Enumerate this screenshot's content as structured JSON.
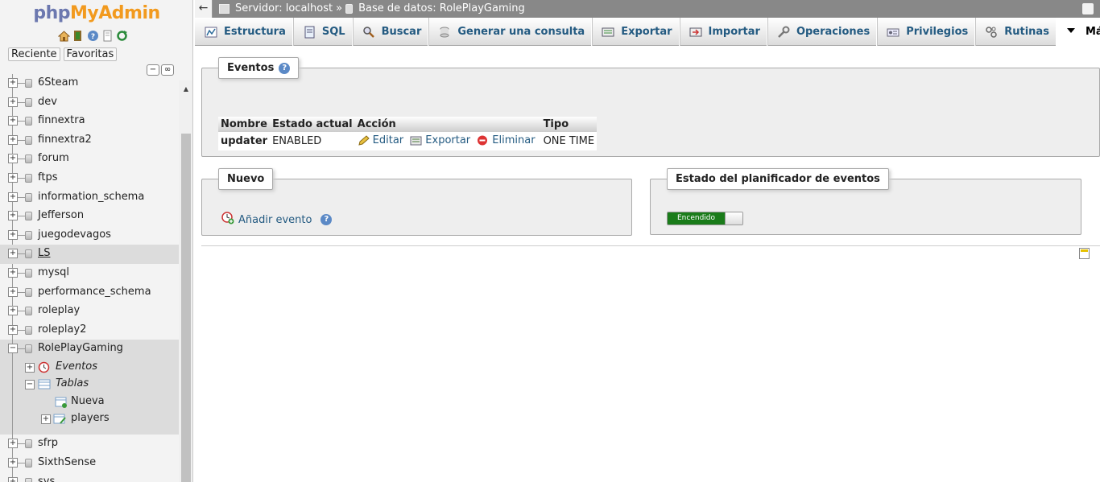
{
  "logo": {
    "left": "php",
    "right": "MyAdmin"
  },
  "nav": {
    "tabs": [
      "Reciente",
      "Favoritas"
    ],
    "icons": [
      "home-icon",
      "logout-icon",
      "help-icon",
      "docs-icon",
      "reload-icon"
    ]
  },
  "tree": {
    "databases_top": [
      {
        "label": "6Steam",
        "underline": false,
        "highlight": false
      },
      {
        "label": "dev",
        "underline": false,
        "highlight": false
      },
      {
        "label": "finnextra",
        "underline": false,
        "highlight": false
      },
      {
        "label": "finnextra2",
        "underline": false,
        "highlight": false
      },
      {
        "label": "forum",
        "underline": false,
        "highlight": false
      },
      {
        "label": "ftps",
        "underline": false,
        "highlight": false
      },
      {
        "label": "information_schema",
        "underline": false,
        "highlight": false
      },
      {
        "label": "Jefferson",
        "underline": false,
        "highlight": false
      },
      {
        "label": "juegodevagos",
        "underline": false,
        "highlight": false
      },
      {
        "label": "LS",
        "underline": true,
        "highlight": true
      },
      {
        "label": "mysql",
        "underline": false,
        "highlight": false
      },
      {
        "label": "performance_schema",
        "underline": false,
        "highlight": false
      },
      {
        "label": "roleplay",
        "underline": false,
        "highlight": false
      },
      {
        "label": "roleplay2",
        "underline": false,
        "highlight": false
      }
    ],
    "active_db": {
      "label": "RolePlayGaming",
      "children": {
        "events": "Eventos",
        "tables": "Tablas",
        "new": "Nueva",
        "players": "players"
      }
    },
    "databases_bottom": [
      {
        "label": "sfrp",
        "underline": false,
        "highlight": false
      },
      {
        "label": "SixthSense",
        "underline": false,
        "highlight": false
      },
      {
        "label": "sys",
        "underline": false,
        "highlight": false
      }
    ]
  },
  "breadcrumb": {
    "server_label": "Servidor: localhost",
    "separator": "»",
    "db_label": "Base de datos: RolePlayGaming"
  },
  "menu": {
    "tabs": [
      {
        "label": "Estructura",
        "icon": "structure-icon",
        "active": false
      },
      {
        "label": "SQL",
        "icon": "sql-icon",
        "active": false
      },
      {
        "label": "Buscar",
        "icon": "search-icon",
        "active": false
      },
      {
        "label": "Generar una consulta",
        "icon": "query-icon",
        "active": false
      },
      {
        "label": "Exportar",
        "icon": "export-icon",
        "active": false
      },
      {
        "label": "Importar",
        "icon": "import-icon",
        "active": false
      },
      {
        "label": "Operaciones",
        "icon": "wrench-icon",
        "active": false
      },
      {
        "label": "Privilegios",
        "icon": "privileges-icon",
        "active": false
      },
      {
        "label": "Rutinas",
        "icon": "routines-icon",
        "active": false
      },
      {
        "label": "Más",
        "icon": "caret-down-icon",
        "active": true
      }
    ]
  },
  "events": {
    "legend": "Eventos",
    "headers": [
      "Nombre",
      "Estado actual",
      "Acción",
      "Tipo"
    ],
    "rows": [
      {
        "name": "updater",
        "status": "ENABLED",
        "edit": "Editar",
        "export": "Exportar",
        "delete": "Eliminar",
        "type": "ONE TIME"
      }
    ]
  },
  "new_section": {
    "legend": "Nuevo",
    "add_label": "Añadir evento"
  },
  "scheduler": {
    "legend": "Estado del planificador de eventos",
    "toggle_label": "Encendido",
    "state_on": true
  },
  "colors": {
    "link": "#235a81",
    "toggle_on": "#1a7c1a",
    "logo_left": "#6c78af",
    "logo_right": "#f29a1e"
  }
}
